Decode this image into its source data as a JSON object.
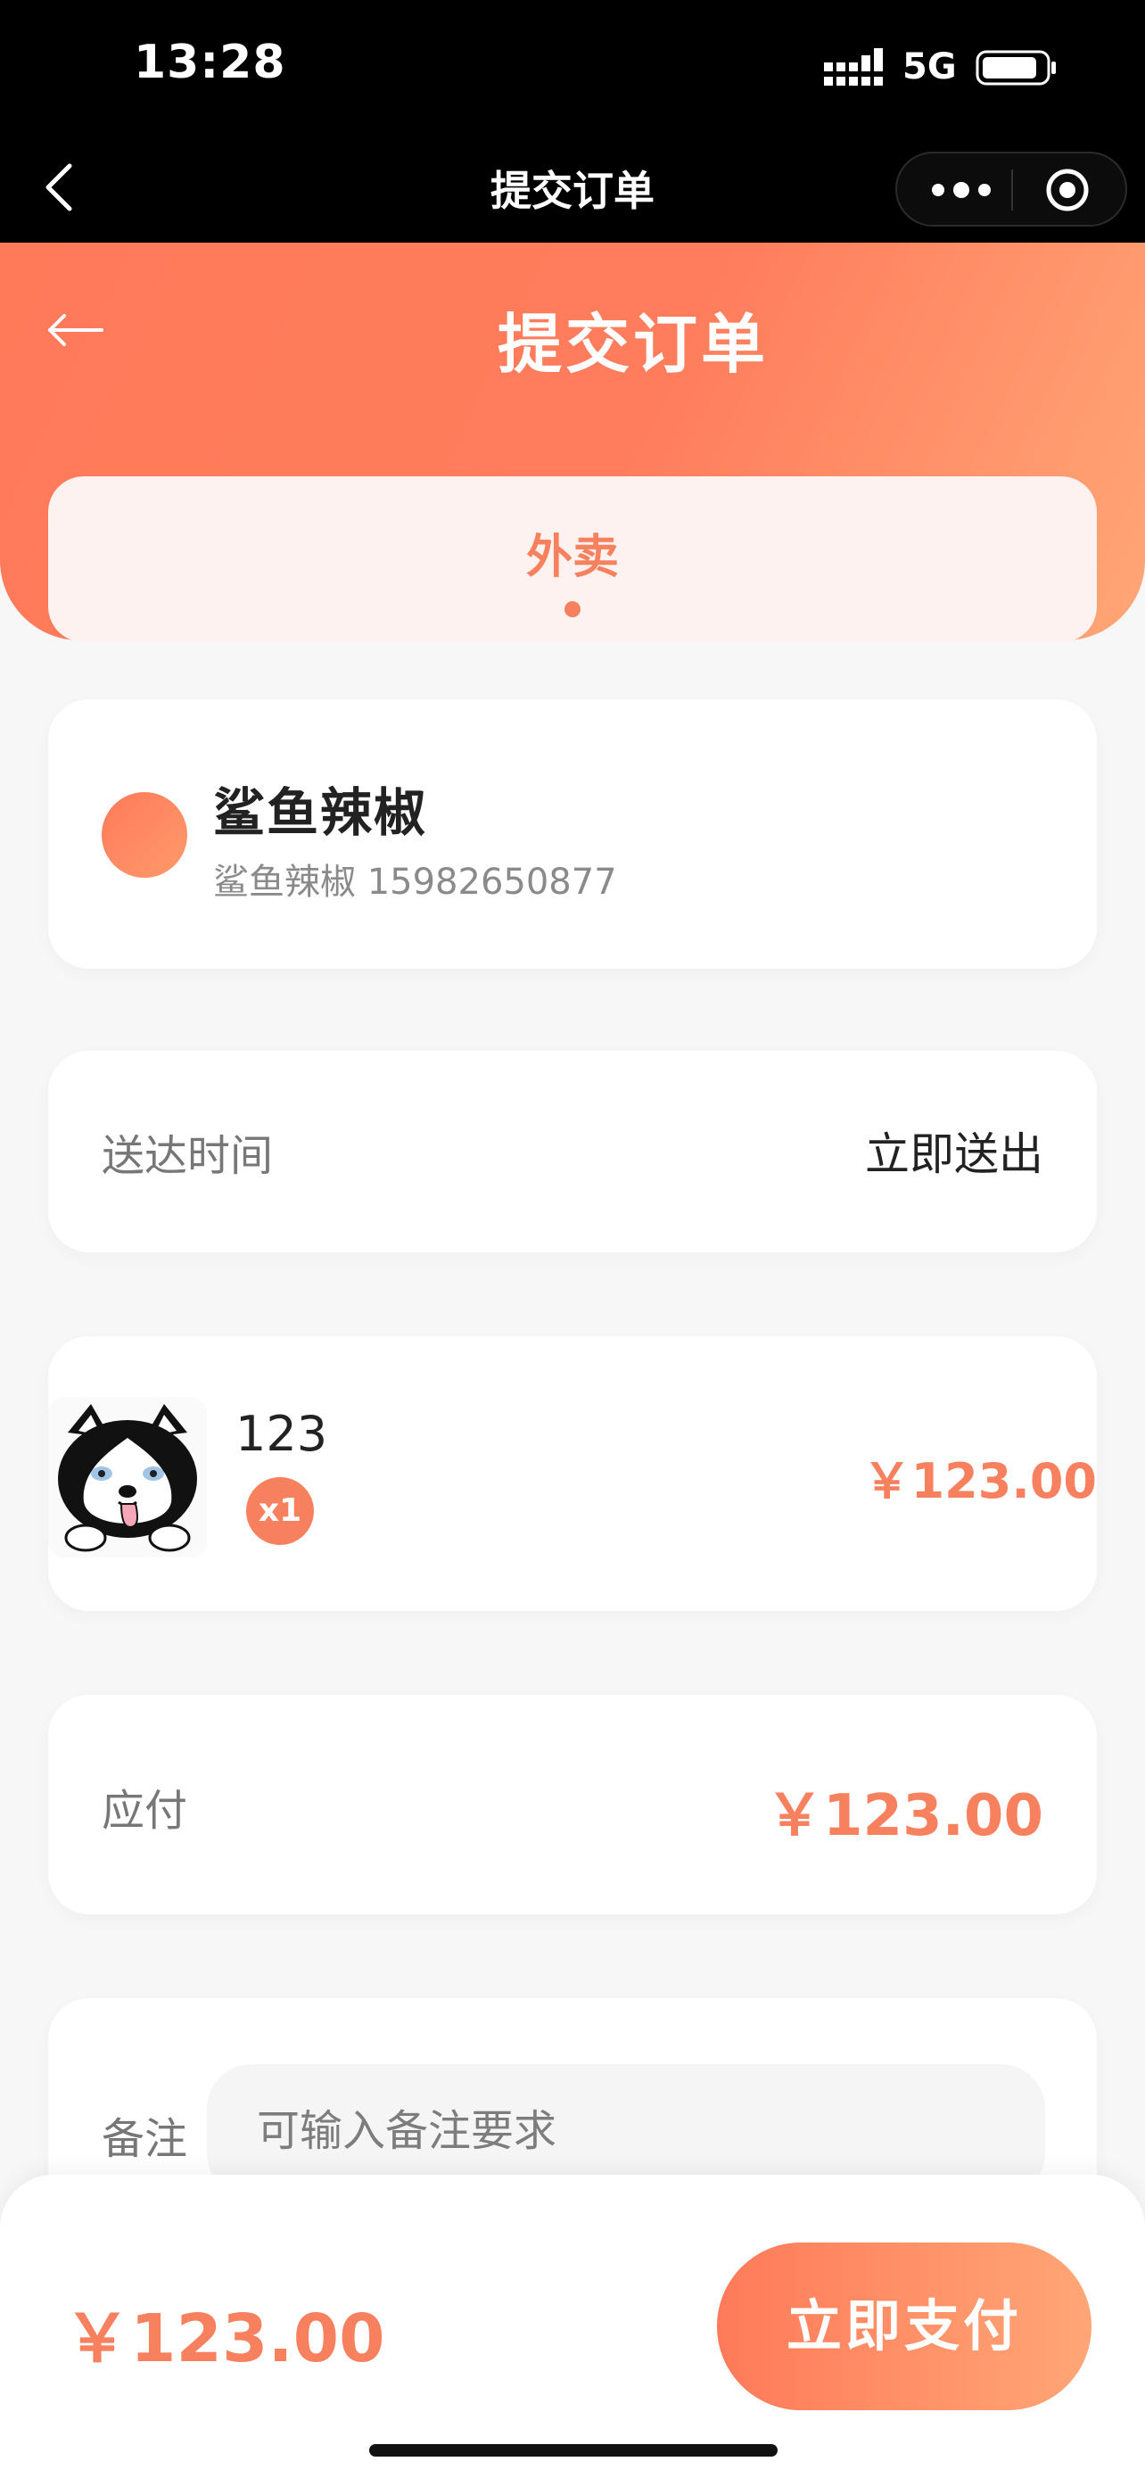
{
  "status_bar": {
    "time": "13:28",
    "network": "5G"
  },
  "nav_bar": {
    "title": "提交订单"
  },
  "header": {
    "title": "提交订单",
    "tab_label": "外卖"
  },
  "user": {
    "name": "鲨鱼辣椒",
    "subtitle": "鲨鱼辣椒 15982650877"
  },
  "delivery": {
    "label": "送达时间",
    "value": "立即送出"
  },
  "item": {
    "name": "123",
    "quantity": "x1",
    "price": "￥123.00"
  },
  "payable": {
    "label": "应付",
    "value": "￥123.00"
  },
  "note": {
    "label": "备注",
    "placeholder": "可输入备注要求"
  },
  "bottom": {
    "total": "￥123.00",
    "pay_button": "立即支付"
  },
  "colors": {
    "accent": "#f7805e",
    "gradient_start": "#ff7a59",
    "gradient_end": "#ffa676"
  }
}
